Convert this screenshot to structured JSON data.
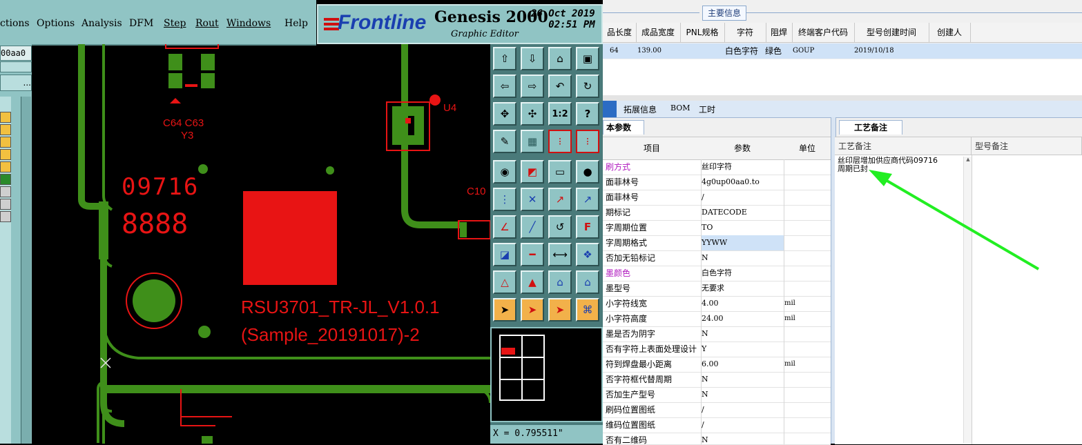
{
  "genesis": {
    "menu": [
      "ctions",
      "Options",
      "Analysis",
      "DFM",
      "Step",
      "Rout",
      "Windows",
      "Help"
    ],
    "brand": "Frontline",
    "product": "Genesis 2000",
    "subtitle": "Graphic Editor",
    "date": "26 Oct 2019",
    "time": "02:51 PM",
    "field_value": "00aa0",
    "field_dots": "...",
    "pcb_labels": {
      "c64c63": "C64 C63",
      "y3": "Y3",
      "u4": "U4",
      "c10": "C10",
      "code1": "09716",
      "code2": "8888",
      "model": "RSU3701_TR-JL_V1.0.1",
      "sample": "(Sample_20191017)-2"
    },
    "coord": "X = 0.795511\"",
    "tool_labels": {
      "ratio": "1:2",
      "help": "?"
    }
  },
  "erp": {
    "section_title": "主要信息",
    "columns": [
      "品长度",
      "成品宽度",
      "PNL规格",
      "字符",
      "阻焊",
      "终端客户代码",
      "型号创建时间",
      "创建人"
    ],
    "row": {
      "length": "64",
      "width": "139.00",
      "pnl": "",
      "char": "白色字符",
      "mask": "绿色",
      "customer": "GOUP",
      "created": "2019/10/18",
      "creator": ""
    },
    "tabs": [
      "拓展信息",
      "BOM",
      "工时"
    ],
    "left_tab": "本参数",
    "left_headers": [
      "项目",
      "参数",
      "单位"
    ],
    "params": [
      {
        "item": "刷方式",
        "value": "丝印字符",
        "unit": "",
        "colored": true
      },
      {
        "item": "面菲林号",
        "value": "4g0up00aa0.to",
        "unit": ""
      },
      {
        "item": "面菲林号",
        "value": "/",
        "unit": ""
      },
      {
        "item": "期标记",
        "value": "DATECODE",
        "unit": ""
      },
      {
        "item": "字周期位置",
        "value": "TO",
        "unit": ""
      },
      {
        "item": "字周期格式",
        "value": "YYWW",
        "unit": "",
        "highlight": true
      },
      {
        "item": "否加无铅标记",
        "value": "N",
        "unit": ""
      },
      {
        "item": "墨颜色",
        "value": "白色字符",
        "unit": "",
        "colored": true
      },
      {
        "item": "墨型号",
        "value": "无要求",
        "unit": ""
      },
      {
        "item": "小字符线宽",
        "value": "4.00",
        "unit": "mil"
      },
      {
        "item": "小字符高度",
        "value": "24.00",
        "unit": "mil"
      },
      {
        "item": "墨是否为阴字",
        "value": "N",
        "unit": ""
      },
      {
        "item": "否有字符上表面处理设计",
        "value": "Y",
        "unit": ""
      },
      {
        "item": "符到焊盘最小距离",
        "value": "6.00",
        "unit": "mil"
      },
      {
        "item": "否字符框代替周期",
        "value": "N",
        "unit": ""
      },
      {
        "item": "否加生产型号",
        "value": "N",
        "unit": ""
      },
      {
        "item": "刷码位置图纸",
        "value": "/",
        "unit": ""
      },
      {
        "item": "维码位置图纸",
        "value": "/",
        "unit": ""
      },
      {
        "item": "否有二维码",
        "value": "N",
        "unit": ""
      }
    ],
    "right_tab": "工艺备注",
    "right_headers": [
      "工艺备注",
      "型号备注"
    ],
    "remark": "丝印层增加供应商代码09716\n周期已封"
  },
  "colors": {
    "copper": "#3f8f1a",
    "silk": "#e81414",
    "tool_bg": "#90c4c4",
    "arrow": "#22ee22"
  }
}
